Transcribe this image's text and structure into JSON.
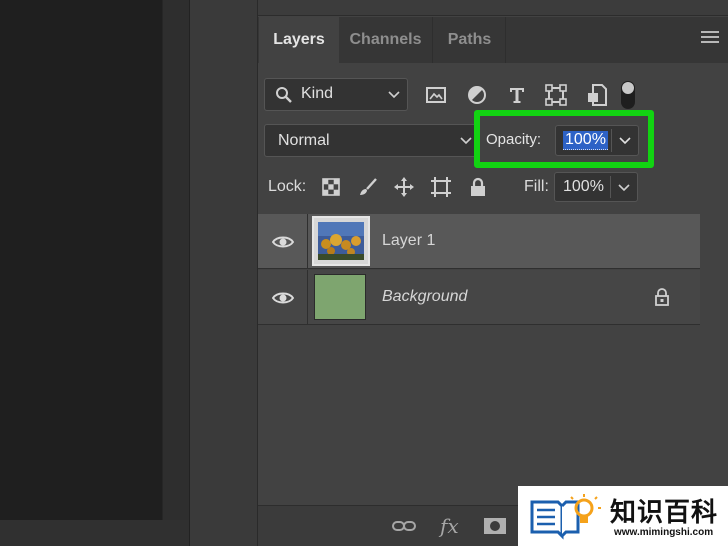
{
  "panel": {
    "tabs": [
      {
        "label": "Layers",
        "active": true
      },
      {
        "label": "Channels",
        "active": false
      },
      {
        "label": "Paths",
        "active": false
      }
    ],
    "menu_icon": "hamburger-icon"
  },
  "filter": {
    "kind_label": "Kind",
    "icons": [
      "image-filter-icon",
      "adjustment-filter-icon",
      "type-filter-icon",
      "shape-filter-icon",
      "smart-object-filter-icon",
      "filter-toggle-icon"
    ]
  },
  "blend": {
    "mode": "Normal"
  },
  "opacity": {
    "label": "Opacity:",
    "value": "100%",
    "highlight_color": "#12d312"
  },
  "locks": {
    "label": "Lock:",
    "icons": [
      "lock-transparent-pixels-icon",
      "lock-image-pixels-icon",
      "lock-position-icon",
      "lock-artboard-icon",
      "lock-all-icon"
    ]
  },
  "fill": {
    "label": "Fill:",
    "value": "100%"
  },
  "layers": [
    {
      "name": "Layer 1",
      "visible": true,
      "selected": true,
      "thumbnail": "photo-thumbnail"
    },
    {
      "name": "Background",
      "visible": true,
      "selected": false,
      "locked": true,
      "thumbnail_color": "#7ea56f"
    }
  ],
  "footer": {
    "icons": [
      "link-layers-icon",
      "fx-icon",
      "layer-mask-icon"
    ],
    "fx_label": "fx"
  },
  "watermark": {
    "text": "知识百科",
    "url": "www.mimingshi.com"
  }
}
